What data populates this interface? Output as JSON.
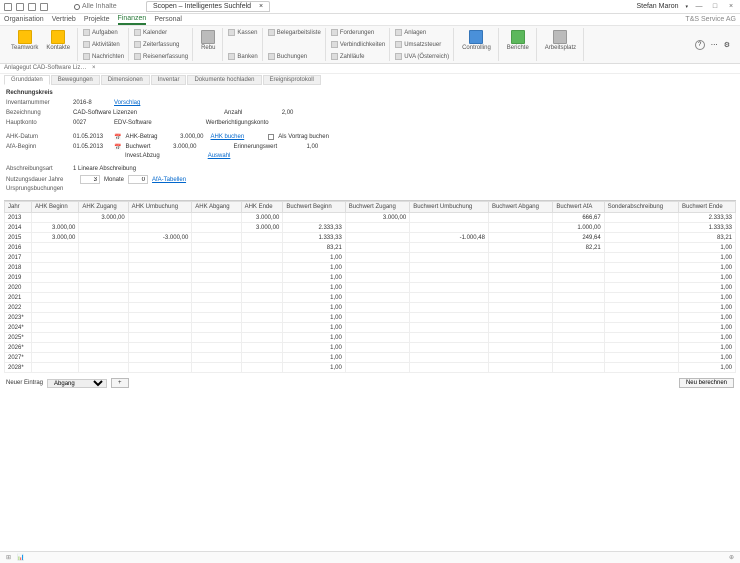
{
  "titlebar": {
    "search_placeholder": "Alle Inhalte",
    "app_title": "Scopen – Intelligentes Suchfeld",
    "user": "Stefan Maron",
    "company": "T&S Service AG"
  },
  "menu": {
    "items": [
      "Organisation",
      "Vertrieb",
      "Projekte",
      "Finanzen",
      "Personal"
    ],
    "active_index": 3
  },
  "ribbon": {
    "teamwork": "Teamwork",
    "kontakte": "Kontakte",
    "aufgaben": "Aufgaben",
    "aktivitaeten": "Aktivitäten",
    "nachrichten": "Nachrichten",
    "kalender": "Kalender",
    "zeiterfassung": "Zeiterfassung",
    "reisen": "Reisenerfassung",
    "rebu": "Rebu",
    "kassen": "Kassen",
    "banken": "Banken",
    "belegarbeitsliste": "Belegarbeitsliste",
    "buchungen": "Buchungen",
    "forderungen": "Forderungen",
    "verbindlichkeiten": "Verbindlichkeiten",
    "zahllaeufe": "Zahlläufe",
    "anlagen": "Anlagen",
    "umsatzsteuer": "Umsatzsteuer",
    "uva": "UVA (Österreich)",
    "controlling": "Controlling",
    "berichte": "Berichte",
    "arbeitsplatz": "Arbeitsplatz"
  },
  "breadcrumb": "Anlagegut CAD-Software Liz…",
  "subtabs": {
    "items": [
      "Grunddaten",
      "Bewegungen",
      "Dimensionen",
      "Inventar",
      "Dokumente hochladen",
      "Ereignisprotokoll"
    ],
    "active_index": 0
  },
  "form": {
    "section": "Rechnungskreis",
    "inventarnummer_label": "Inventarnummer",
    "inventarnummer": "2016-8",
    "vorschlag": "Vorschlag",
    "bezeichnung_label": "Bezeichnung",
    "bezeichnung": "CAD-Software Lizenzen",
    "hauptkonto_label": "Hauptkonto",
    "hauptkonto": "0027",
    "hauptkonto_text": "EDV-Software",
    "anzahl_label": "Anzahl",
    "anzahl": "2,00",
    "wertberichtigung_label": "Wertberichtigungskonto",
    "ahk_datum_label": "AHK-Datum",
    "ahk_datum": "01.05.2013",
    "ahk_betrag_label": "AHK-Betrag",
    "ahk_betrag": "3.000,00",
    "ahk_buchen": "AHK buchen",
    "als_vortrag": "Als Vortrag buchen",
    "afa_beginn_label": "AfA-Beginn",
    "afa_beginn": "01.05.2013",
    "buchwert_label": "Buchwert",
    "buchwert": "3.000,00",
    "erinnerungswert_label": "Erinnerungswert",
    "erinnerungswert": "1,00",
    "invest_abzug_label": "Invest.Abzug",
    "auswahl": "Auswahl",
    "abschreibungsart_label": "Abschreibungsart",
    "abschreibungsart": "1 Lineare Abschreibung",
    "nutzungsdauer_label": "Nutzungsdauer Jahre",
    "jahre": "3",
    "monate_label": "Monate",
    "monate": "0",
    "afa_tabellen": "AfA-Tabellen",
    "ursprung_label": "Ursprungsbuchungen"
  },
  "table": {
    "headers": [
      "Jahr",
      "AHK Beginn",
      "AHK Zugang",
      "AHK Umbuchung",
      "AHK Abgang",
      "AHK Ende",
      "Buchwert Beginn",
      "Buchwert Zugang",
      "Buchwert Umbuchung",
      "Buchwert Abgang",
      "Buchwert AfA",
      "Sonderabschreibung",
      "Buchwert Ende"
    ],
    "rows": [
      {
        "y": "2013",
        "c": [
          "",
          "3.000,00",
          "",
          "",
          "3.000,00",
          "",
          "3.000,00",
          "",
          "",
          "666,67",
          "",
          "2.333,33"
        ]
      },
      {
        "y": "2014",
        "c": [
          "3.000,00",
          "",
          "",
          "",
          "3.000,00",
          "2.333,33",
          "",
          "",
          "",
          "1.000,00",
          "",
          "1.333,33"
        ]
      },
      {
        "y": "2015",
        "c": [
          "3.000,00",
          "",
          "-3.000,00",
          "",
          "",
          "1.333,33",
          "",
          "-1.000,48",
          "",
          "249,64",
          "",
          "83,21"
        ]
      },
      {
        "y": "2016",
        "c": [
          "",
          "",
          "",
          "",
          "",
          "83,21",
          "",
          "",
          "",
          "82,21",
          "",
          "1,00"
        ]
      },
      {
        "y": "2017",
        "c": [
          "",
          "",
          "",
          "",
          "",
          "1,00",
          "",
          "",
          "",
          "",
          "",
          "1,00"
        ]
      },
      {
        "y": "2018",
        "c": [
          "",
          "",
          "",
          "",
          "",
          "1,00",
          "",
          "",
          "",
          "",
          "",
          "1,00"
        ]
      },
      {
        "y": "2019",
        "c": [
          "",
          "",
          "",
          "",
          "",
          "1,00",
          "",
          "",
          "",
          "",
          "",
          "1,00"
        ]
      },
      {
        "y": "2020",
        "c": [
          "",
          "",
          "",
          "",
          "",
          "1,00",
          "",
          "",
          "",
          "",
          "",
          "1,00"
        ]
      },
      {
        "y": "2021",
        "c": [
          "",
          "",
          "",
          "",
          "",
          "1,00",
          "",
          "",
          "",
          "",
          "",
          "1,00"
        ]
      },
      {
        "y": "2022",
        "c": [
          "",
          "",
          "",
          "",
          "",
          "1,00",
          "",
          "",
          "",
          "",
          "",
          "1,00"
        ]
      },
      {
        "y": "2023*",
        "c": [
          "",
          "",
          "",
          "",
          "",
          "1,00",
          "",
          "",
          "",
          "",
          "",
          "1,00"
        ]
      },
      {
        "y": "2024*",
        "c": [
          "",
          "",
          "",
          "",
          "",
          "1,00",
          "",
          "",
          "",
          "",
          "",
          "1,00"
        ]
      },
      {
        "y": "2025*",
        "c": [
          "",
          "",
          "",
          "",
          "",
          "1,00",
          "",
          "",
          "",
          "",
          "",
          "1,00"
        ]
      },
      {
        "y": "2026*",
        "c": [
          "",
          "",
          "",
          "",
          "",
          "1,00",
          "",
          "",
          "",
          "",
          "",
          "1,00"
        ]
      },
      {
        "y": "2027*",
        "c": [
          "",
          "",
          "",
          "",
          "",
          "1,00",
          "",
          "",
          "",
          "",
          "",
          "1,00"
        ]
      },
      {
        "y": "2028*",
        "c": [
          "",
          "",
          "",
          "",
          "",
          "1,00",
          "",
          "",
          "",
          "",
          "",
          "1,00"
        ]
      }
    ]
  },
  "footer": {
    "neuer_eintrag": "Neuer Eintrag",
    "abgang": "Abgang",
    "neu_berechnen": "Neu berechnen"
  }
}
